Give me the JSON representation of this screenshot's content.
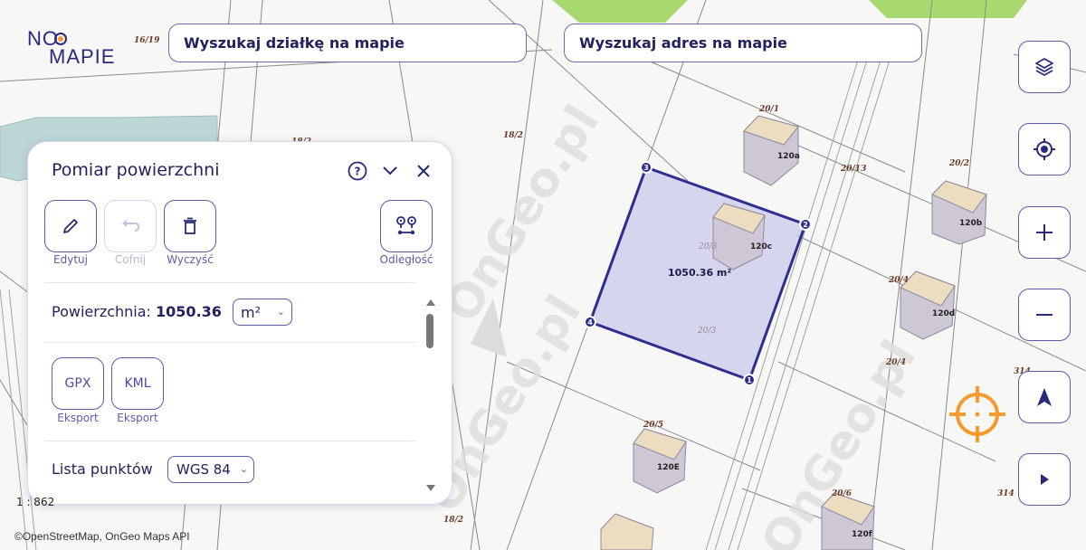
{
  "logo": {
    "line1": "NO",
    "line2": "MAPIE",
    "version": "16/19"
  },
  "search": {
    "parcel_placeholder": "Wyszukaj działkę na mapie",
    "address_placeholder": "Wyszukaj adres na mapie"
  },
  "map_controls": [
    "layers-icon",
    "locate-icon",
    "zoom-in-icon",
    "zoom-out-icon",
    "north-arrow-icon",
    "expand-right-icon"
  ],
  "map": {
    "parcel_labels": [
      "18/2",
      "18/2",
      "18/2",
      "20/1",
      "20/13",
      "20/2",
      "20/4",
      "20/4",
      "20/5",
      "20/6",
      "314",
      "314"
    ],
    "building_labels": [
      "120a",
      "120b",
      "120c",
      "120d",
      "120E",
      "120f"
    ],
    "measured_area_label": "1050.36 m²",
    "parcel_inner_labels": [
      "20/3",
      "20/3"
    ],
    "vertices": [
      "1",
      "2",
      "3",
      "4"
    ],
    "watermark": "OnGeo.pl",
    "scale_text": "1 : 862",
    "attribution": "©OpenStreetMap, OnGeo Maps API"
  },
  "panel": {
    "title": "Pomiar powierzchni",
    "tools": {
      "edit_label": "Edytuj",
      "undo_label": "Cofnij",
      "clear_label": "Wyczyść",
      "distance_label": "Odległość"
    },
    "area": {
      "label": "Powierzchnia:",
      "value": "1050.36",
      "unit": "m²"
    },
    "export": {
      "gpx_label": "GPX",
      "kml_label": "KML",
      "gpx_caption": "Eksport",
      "kml_caption": "Eksport"
    },
    "points": {
      "label": "Lista punktów",
      "crs": "WGS 84"
    }
  },
  "colors": {
    "accent": "#2e2e8f",
    "polygon_fill": "#c9c9ea",
    "building_top": "#ecdcc0",
    "building_side": "#cdc7d6",
    "grass": "#a8d870",
    "water": "#bcd7d6",
    "locator": "#f39b2f"
  }
}
